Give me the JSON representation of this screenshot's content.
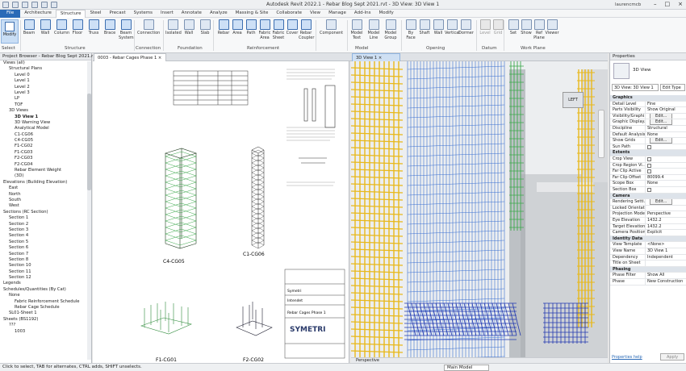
{
  "app": {
    "title": "Autodesk Revit 2022.1 - Rebar Blog Sept 2021.rvt - 3D View: 3D View 1",
    "user": "laurencmcb"
  },
  "menu": [
    "File",
    "Architecture",
    "Structure",
    "Steel",
    "Precast",
    "Systems",
    "Insert",
    "Annotate",
    "Analyze",
    "Massing & Site",
    "Collaborate",
    "View",
    "Manage",
    "Add-Ins",
    "Modify"
  ],
  "ribbon": {
    "modify": "Modify",
    "select": "Select",
    "structure": [
      "Beam",
      "Wall",
      "Column",
      "Floor",
      "Truss",
      "Brace",
      "Beam System"
    ],
    "connection": "Connection",
    "foundation": [
      "Isolated",
      "Wall",
      "Slab"
    ],
    "reinforcement": [
      "Rebar",
      "Area",
      "Path",
      "Fabric Area",
      "Fabric Sheet",
      "Cover",
      "Rebar Coupler"
    ],
    "component": "Component",
    "model": [
      "Model Text",
      "Model Line",
      "Model Group"
    ],
    "opening": [
      "By Face",
      "Shaft",
      "Wall",
      "Vertical",
      "Dormer"
    ],
    "datum": [
      "Level",
      "Grid"
    ],
    "workplane": [
      "Set",
      "Show",
      "Ref Plane",
      "Viewer"
    ],
    "panels": {
      "select": "Select",
      "structure": "Structure",
      "connection": "Connection",
      "foundation": "Foundation",
      "reinforcement": "Reinforcement",
      "model": "Model",
      "opening": "Opening",
      "datum": "Datum",
      "workplane": "Work Plane"
    }
  },
  "browser": {
    "title": "Project Browser - Rebar Blog Sept 2021.rvt",
    "items": [
      "Views (all)",
      "Structural Plans",
      "Level 0",
      "Level 1",
      "Level 2",
      "Level 3",
      "LP",
      "TOF",
      "3D Views",
      "3D View 1",
      "3D Warning View",
      "Analytical Model",
      "C1-CG06",
      "C4-CG05",
      "F1-CG02",
      "F1-CG03",
      "F2-CG03",
      "F2-CG04",
      "Rebar Element Weight",
      "(3D)",
      "Elevations (Building Elevation)",
      "East",
      "North",
      "South",
      "West",
      "Sections (RC Section)",
      "Section 1",
      "Section 2",
      "Section 3",
      "Section 4",
      "Section 5",
      "Section 6",
      "Section 7",
      "Section 8",
      "Section 10",
      "Section 11",
      "Section 12",
      "Legends",
      "Schedules/Quantities (By Cat)",
      "None",
      "Fabric Reinforcement Schedule",
      "Rebar Cage Schedule",
      "SL01-Sheet 1",
      "Sheets (BS1192)",
      "???",
      "1003"
    ]
  },
  "tabs": {
    "sheet": "0003 - Rebar Cages Phase 1",
    "view3d": "3D View 1"
  },
  "sheet": {
    "labels": [
      "C4-CG05",
      "C1-CG06",
      "F1-CG01",
      "F2-CG02"
    ],
    "company": "SYMETRI",
    "titleblock": [
      "Rebar Cages Phase 1",
      "Symetri",
      "Intendet"
    ]
  },
  "view3d": {
    "scale": "Perspective",
    "cube": "LEFT"
  },
  "props": {
    "title": "Properties",
    "type": "3D View",
    "selector": "3D View: 3D View 1",
    "edit": "Edit Type",
    "rows": [
      {
        "s": "Graphics"
      },
      {
        "k": "Detail Level",
        "v": "Fine"
      },
      {
        "k": "Parts Visibility",
        "v": "Show Original"
      },
      {
        "k": "Visibility/Graphi...",
        "v": "Edit...",
        "btn": true
      },
      {
        "k": "Graphic Display...",
        "v": "Edit...",
        "btn": true
      },
      {
        "k": "Discipline",
        "v": "Structural"
      },
      {
        "k": "Default Analysis...",
        "v": "None"
      },
      {
        "k": "Show Grids",
        "v": "Edit...",
        "btn": true
      },
      {
        "k": "Sun Path",
        "v": "",
        "cb": true
      },
      {
        "s": "Extents"
      },
      {
        "k": "Crop View",
        "v": "",
        "cb": true
      },
      {
        "k": "Crop Region Vi...",
        "v": "",
        "cb": true
      },
      {
        "k": "Far Clip Active",
        "v": "",
        "cb": true
      },
      {
        "k": "Far Clip Offset",
        "v": "80099.4"
      },
      {
        "k": "Scope Box",
        "v": "None"
      },
      {
        "k": "Section Box",
        "v": "",
        "cb": true
      },
      {
        "s": "Camera"
      },
      {
        "k": "Rendering Setti...",
        "v": "Edit...",
        "btn": true
      },
      {
        "k": "Locked Orientat...",
        "v": ""
      },
      {
        "k": "Projection Mode",
        "v": "Perspective"
      },
      {
        "k": "Eye Elevation",
        "v": "1432.2"
      },
      {
        "k": "Target Elevation",
        "v": "1432.2"
      },
      {
        "k": "Camera Position",
        "v": "Explicit"
      },
      {
        "s": "Identity Data"
      },
      {
        "k": "View Template",
        "v": "<None>"
      },
      {
        "k": "View Name",
        "v": "3D View 1"
      },
      {
        "k": "Dependency",
        "v": "Independent"
      },
      {
        "k": "Title on Sheet",
        "v": ""
      },
      {
        "s": "Phasing"
      },
      {
        "k": "Phase Filter",
        "v": "Show All"
      },
      {
        "k": "Phase",
        "v": "New Construction"
      }
    ],
    "help": "Properties help",
    "apply": "Apply"
  },
  "status": {
    "text": "Click to select, TAB for alternates, CTRL adds, SHIFT unselects.",
    "model": "Main Model"
  },
  "colors": {
    "accent": "#2a6ab7",
    "rebarYellow": "#e8b81a",
    "rebarBlue": "#3a6fd0",
    "rebarGreen": "#3aa84a"
  }
}
